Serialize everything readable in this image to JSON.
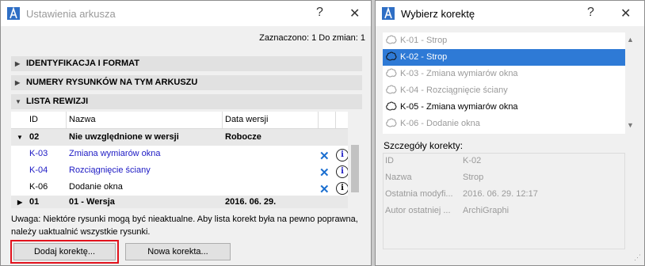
{
  "left_dialog": {
    "title": "Ustawienia arkusza",
    "help_glyph": "?",
    "close_glyph": "✕",
    "selection_count": "Zaznaczono: 1 Do zmian: 1",
    "sections": [
      {
        "label": "IDENTYFIKACJA I FORMAT",
        "expanded": false
      },
      {
        "label": "NUMERY RYSUNKÓW NA TYM ARKUSZU",
        "expanded": false
      },
      {
        "label": "LISTA REWIZJI",
        "expanded": true
      }
    ],
    "table": {
      "columns": [
        "ID",
        "Nazwa",
        "Data wersji"
      ],
      "rows": [
        {
          "type": "group",
          "id": "02",
          "name": "Nie uwzględnione w wersji",
          "date": "Robocze",
          "expanded": true
        },
        {
          "type": "item",
          "id": "K-03",
          "name": "Zmiana wymiarów okna",
          "blue": true
        },
        {
          "type": "item",
          "id": "K-04",
          "name": "Rozciągnięcie ściany",
          "blue": true
        },
        {
          "type": "item",
          "id": "K-06",
          "name": "Dodanie okna",
          "blue": false
        },
        {
          "type": "group",
          "id": "01",
          "name": "01 - Wersja",
          "date": "2016. 06. 29.",
          "expanded": false
        }
      ]
    },
    "note": "Uwaga: Niektóre rysunki mogą być nieaktualne. Aby lista korekt była na pewno poprawna, należy uaktualnić wszystkie rysunki.",
    "buttons": {
      "add": "Dodaj korektę...",
      "new": "Nowa korekta..."
    }
  },
  "right_dialog": {
    "title": "Wybierz korektę",
    "help_glyph": "?",
    "close_glyph": "✕",
    "items": [
      {
        "label": "K-01 - Strop",
        "state": "dim"
      },
      {
        "label": "K-02 - Strop",
        "state": "selected"
      },
      {
        "label": "K-03 - Zmiana wymiarów okna",
        "state": "dim"
      },
      {
        "label": "K-04 - Rozciągnięcie ściany",
        "state": "dim"
      },
      {
        "label": "K-05 - Zmiana wymiarów okna",
        "state": "normal"
      },
      {
        "label": "K-06 - Dodanie okna",
        "state": "dim"
      }
    ],
    "details_title": "Szczegóły korekty:",
    "details": [
      {
        "key": "ID",
        "value": "K-02"
      },
      {
        "key": "Nazwa",
        "value": "Strop"
      },
      {
        "key": "Ostatnia modyfi...",
        "value": "2016. 06. 29. 12:17"
      },
      {
        "key": "Autor ostatniej ...",
        "value": "ArchiGraphi"
      }
    ]
  },
  "colors": {
    "accent": "#2e7ad6",
    "highlight_border": "#e2131d",
    "link_blue": "#1d1ac4",
    "x_icon": "#1b6fd0"
  }
}
